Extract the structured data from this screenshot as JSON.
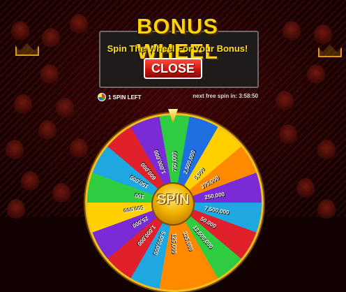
{
  "header": {
    "title": "BONUS WHEEL",
    "subtitle": "Spin The Wheel For Your Bonus!",
    "close_label": "CLOSE"
  },
  "status": {
    "spins_left": "1 SPIN LEFT",
    "next_free_spin": "next free spin in: 3:58:50"
  },
  "wheel": {
    "spin_label": "SPIN",
    "segments": [
      {
        "value": "750,000",
        "color": "#2ecc40"
      },
      {
        "value": "2,500,000",
        "color": "#1e6fe0"
      },
      {
        "value": "5,000",
        "color": "#ffd000"
      },
      {
        "value": "375,000",
        "color": "#ff8a00"
      },
      {
        "value": "250,000",
        "color": "#7a2bd6"
      },
      {
        "value": "7,500,000",
        "color": "#1ea7e0"
      },
      {
        "value": "50,000",
        "color": "#e0202a"
      },
      {
        "value": "12,500,000",
        "color": "#2ecc40"
      },
      {
        "value": "325,000",
        "color": "#ff8a00"
      },
      {
        "value": "125,000",
        "color": "#ff8a00"
      },
      {
        "value": "5,000,000",
        "color": "#1ea7e0"
      },
      {
        "value": "1,000,000",
        "color": "#e0202a"
      },
      {
        "value": "25,000",
        "color": "#7a2bd6"
      },
      {
        "value": "500,000",
        "color": "#ffd000"
      },
      {
        "value": "100",
        "color": "#2ecc40"
      },
      {
        "value": "150,000",
        "color": "#1ea7e0"
      },
      {
        "value": "600,000",
        "color": "#e0202a"
      },
      {
        "value": "1,000,000",
        "color": "#7a2bd6"
      }
    ]
  }
}
